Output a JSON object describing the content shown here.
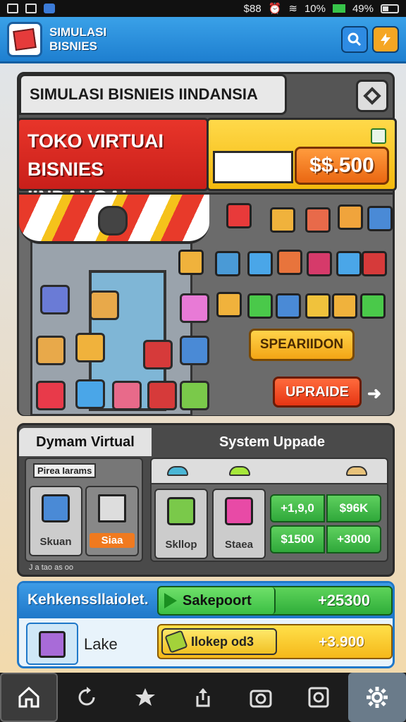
{
  "status_bar": {
    "left_icons": [
      "gallery-icon",
      "m-icon",
      "facebook-icon"
    ],
    "right_text": "$88",
    "battery_percent_a": "10%",
    "battery_percent_b": "49%"
  },
  "app_bar": {
    "title_line1": "SIMULASI",
    "title_line2": "BISNIES",
    "search_icon": "search-icon",
    "lightning_icon": "lightning-icon"
  },
  "top_panel": {
    "title": "SIMULASI BISNIEIS IINDANSIA",
    "store_line1": "TOKO VIRTUAI",
    "store_line2": "BISNIES  IINDANGAI",
    "price": "$$.500",
    "search_button": "SPEARIIDON",
    "upgrade_button": "UPRAIDE"
  },
  "mid_panel": {
    "left_header": "Dymam Virtual",
    "right_header": "System Uppade",
    "sub_label": "Pirea Iarams",
    "tile1_label": "Skuan",
    "tile2_label": "Siaa",
    "tile3_label": "Skllop",
    "tile4_label": "Staea",
    "green_buttons": [
      "+1,9,0",
      "$96K",
      "$1500",
      "+3000"
    ],
    "footnote": "J  a tao  as oo"
  },
  "bottom_panel": {
    "title": "Kehkenssllaiolet.",
    "green_button": "Sakepoort",
    "green_value": "+25300",
    "lake_label": "Lake",
    "yellow_button": "Ilokep od3",
    "yellow_value": "+3.900"
  },
  "nav": [
    "home-icon",
    "refresh-icon",
    "star-icon",
    "share-icon",
    "camera-icon",
    "photo-icon",
    "settings-icon"
  ]
}
